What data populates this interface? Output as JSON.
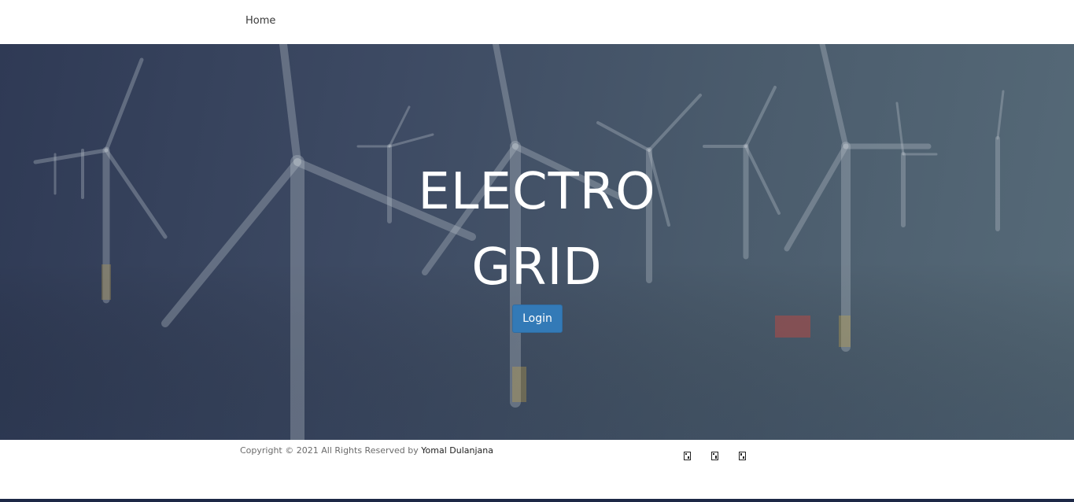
{
  "nav": {
    "home_label": "Home"
  },
  "hero": {
    "title_line1": "ELECTRO",
    "title_line2": "GRID",
    "login_label": "Login"
  },
  "footer": {
    "copyright_text": "Copyright © 2021 All Rights Reserved by ",
    "author_name": "Yomal Dulanjana",
    "social_icons": [
      "facebook-icon",
      "twitter-icon",
      "linkedin-icon"
    ]
  },
  "colors": {
    "primary_button": "#337ab7",
    "hero_overlay": "#3d4a63",
    "footer_bar": "#1d2846"
  }
}
